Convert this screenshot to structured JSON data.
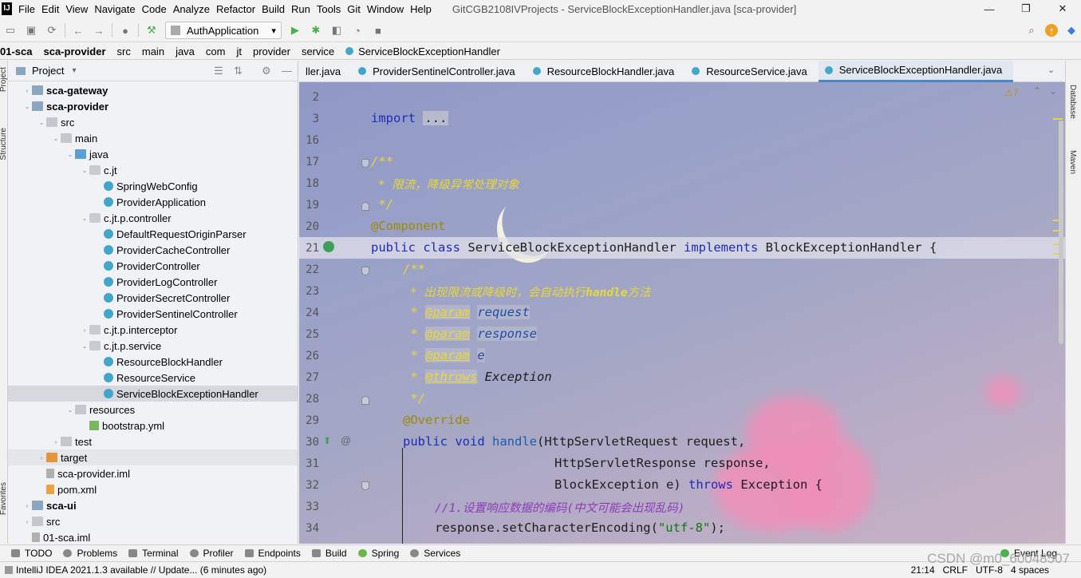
{
  "app": {
    "logo": "IJ",
    "window_title": "GitCGB2108IVProjects - ServiceBlockExceptionHandler.java [sca-provider]",
    "menu": [
      "File",
      "Edit",
      "View",
      "Navigate",
      "Code",
      "Analyze",
      "Refactor",
      "Build",
      "Run",
      "Tools",
      "Git",
      "Window",
      "Help"
    ],
    "win_controls": {
      "minimize": "—",
      "maximize": "❐",
      "close": "✕"
    }
  },
  "toolbar": {
    "run_config": "AuthApplication",
    "run_config_arrow": "▾"
  },
  "breadcrumb": [
    "01-sca",
    "sca-provider",
    "src",
    "main",
    "java",
    "com",
    "jt",
    "provider",
    "service",
    "ServiceBlockExceptionHandler"
  ],
  "left_stripe": {
    "project": "Project",
    "structure": "Structure",
    "favorites": "Favorites"
  },
  "right_stripe": {
    "database": "Database",
    "maven": "Maven"
  },
  "project_panel": {
    "title": "Project",
    "tree": [
      {
        "label": "sca-gateway",
        "depth": 2,
        "icon": "module",
        "arrow": "›",
        "bold": true
      },
      {
        "label": "sca-provider",
        "depth": 2,
        "icon": "module",
        "arrow": "⌄",
        "bold": true
      },
      {
        "label": "src",
        "depth": 3,
        "icon": "folder",
        "arrow": "⌄"
      },
      {
        "label": "main",
        "depth": 4,
        "icon": "folder",
        "arrow": "⌄"
      },
      {
        "label": "java",
        "depth": 5,
        "icon": "folder-blue",
        "arrow": "⌄"
      },
      {
        "label": "c.jt",
        "depth": 6,
        "icon": "pkg",
        "arrow": "⌄"
      },
      {
        "label": "SpringWebConfig",
        "depth": 7,
        "icon": "class"
      },
      {
        "label": "ProviderApplication",
        "depth": 7,
        "icon": "class"
      },
      {
        "label": "c.jt.p.controller",
        "depth": 6,
        "icon": "pkg",
        "arrow": "⌄"
      },
      {
        "label": "DefaultRequestOriginParser",
        "depth": 7,
        "icon": "class"
      },
      {
        "label": "ProviderCacheController",
        "depth": 7,
        "icon": "class"
      },
      {
        "label": "ProviderController",
        "depth": 7,
        "icon": "class"
      },
      {
        "label": "ProviderLogController",
        "depth": 7,
        "icon": "class"
      },
      {
        "label": "ProviderSecretController",
        "depth": 7,
        "icon": "class"
      },
      {
        "label": "ProviderSentinelController",
        "depth": 7,
        "icon": "class"
      },
      {
        "label": "c.jt.p.interceptor",
        "depth": 6,
        "icon": "pkg",
        "arrow": "›"
      },
      {
        "label": "c.jt.p.service",
        "depth": 6,
        "icon": "pkg",
        "arrow": "⌄"
      },
      {
        "label": "ResourceBlockHandler",
        "depth": 7,
        "icon": "class"
      },
      {
        "label": "ResourceService",
        "depth": 7,
        "icon": "class"
      },
      {
        "label": "ServiceBlockExceptionHandler",
        "depth": 7,
        "icon": "class",
        "selected": true
      },
      {
        "label": "resources",
        "depth": 5,
        "icon": "folder",
        "arrow": "⌄"
      },
      {
        "label": "bootstrap.yml",
        "depth": 6,
        "icon": "yml"
      },
      {
        "label": "test",
        "depth": 4,
        "icon": "folder",
        "arrow": "›"
      },
      {
        "label": "target",
        "depth": 3,
        "icon": "folder-orange",
        "arrow": "›",
        "band": true
      },
      {
        "label": "sca-provider.iml",
        "depth": 3,
        "icon": "iml"
      },
      {
        "label": "pom.xml",
        "depth": 3,
        "icon": "xml"
      },
      {
        "label": "sca-ui",
        "depth": 2,
        "icon": "module",
        "arrow": "›",
        "bold": true
      },
      {
        "label": "src",
        "depth": 2,
        "icon": "folder",
        "arrow": "›"
      },
      {
        "label": "01-sca.iml",
        "depth": 2,
        "icon": "iml"
      }
    ]
  },
  "editor": {
    "tabs": [
      {
        "label": "ller.java",
        "active": false
      },
      {
        "label": "ProviderSentinelController.java",
        "active": false
      },
      {
        "label": "ResourceBlockHandler.java",
        "active": false
      },
      {
        "label": "ResourceService.java",
        "active": false
      },
      {
        "label": "ServiceBlockExceptionHandler.java",
        "active": true
      }
    ],
    "inspection_badge": "⚠7",
    "line_numbers": [
      "2",
      "3",
      "16",
      "17",
      "18",
      "19",
      "20",
      "21",
      "22",
      "23",
      "24",
      "25",
      "26",
      "27",
      "28",
      "29",
      "30",
      "31",
      "32",
      "33",
      "34"
    ],
    "code": {
      "l3_import": "import",
      "l3_dots": "...",
      "l17": "/**",
      "l18": " * 限流，降级异常处理对象",
      "l19": " */",
      "l20": "@Component",
      "l21_public": "public",
      "l21_class": "class",
      "l21_name": "ServiceBlockExceptionHandler",
      "l21_implements": "implements",
      "l21_iface": "BlockExceptionHandler {",
      "l22": "/**",
      "l23a": " * 出现限流或降级时，会自动执行",
      "l23b": "handle",
      "l23c": "方法",
      "l24_star": " * ",
      "l24_tag": "@param",
      "l24_p": "request",
      "l25_tag": "@param",
      "l25_p": "response",
      "l26_tag": "@param",
      "l26_p": "e",
      "l27_tag": "@throws",
      "l27_p": "Exception",
      "l28": " */",
      "l29": "@Override",
      "l30_public": "public",
      "l30_void": "void",
      "l30_method": "handle",
      "l30_rest": "(HttpServletRequest request,",
      "l31": "HttpServletResponse response,",
      "l32_a": "BlockException e) ",
      "l32_throws": "throws",
      "l32_b": " Exception {",
      "l33": "//1.设置响应数据的编码(中文可能会出现乱码)",
      "l34_a": "response.setCharacterEncoding(",
      "l34_str": "\"utf-8\"",
      "l34_b": ");"
    }
  },
  "bottom_tools": [
    "TODO",
    "Problems",
    "Terminal",
    "Profiler",
    "Endpoints",
    "Build",
    "Spring",
    "Services",
    "Event Log"
  ],
  "status": {
    "message": "IntelliJ IDEA 2021.1.3 available // Update... (6 minutes ago)",
    "position": "21:14",
    "line_sep": "CRLF",
    "encoding": "UTF-8",
    "indent": "4 spaces"
  },
  "watermark": "CSDN @m0_60048507"
}
